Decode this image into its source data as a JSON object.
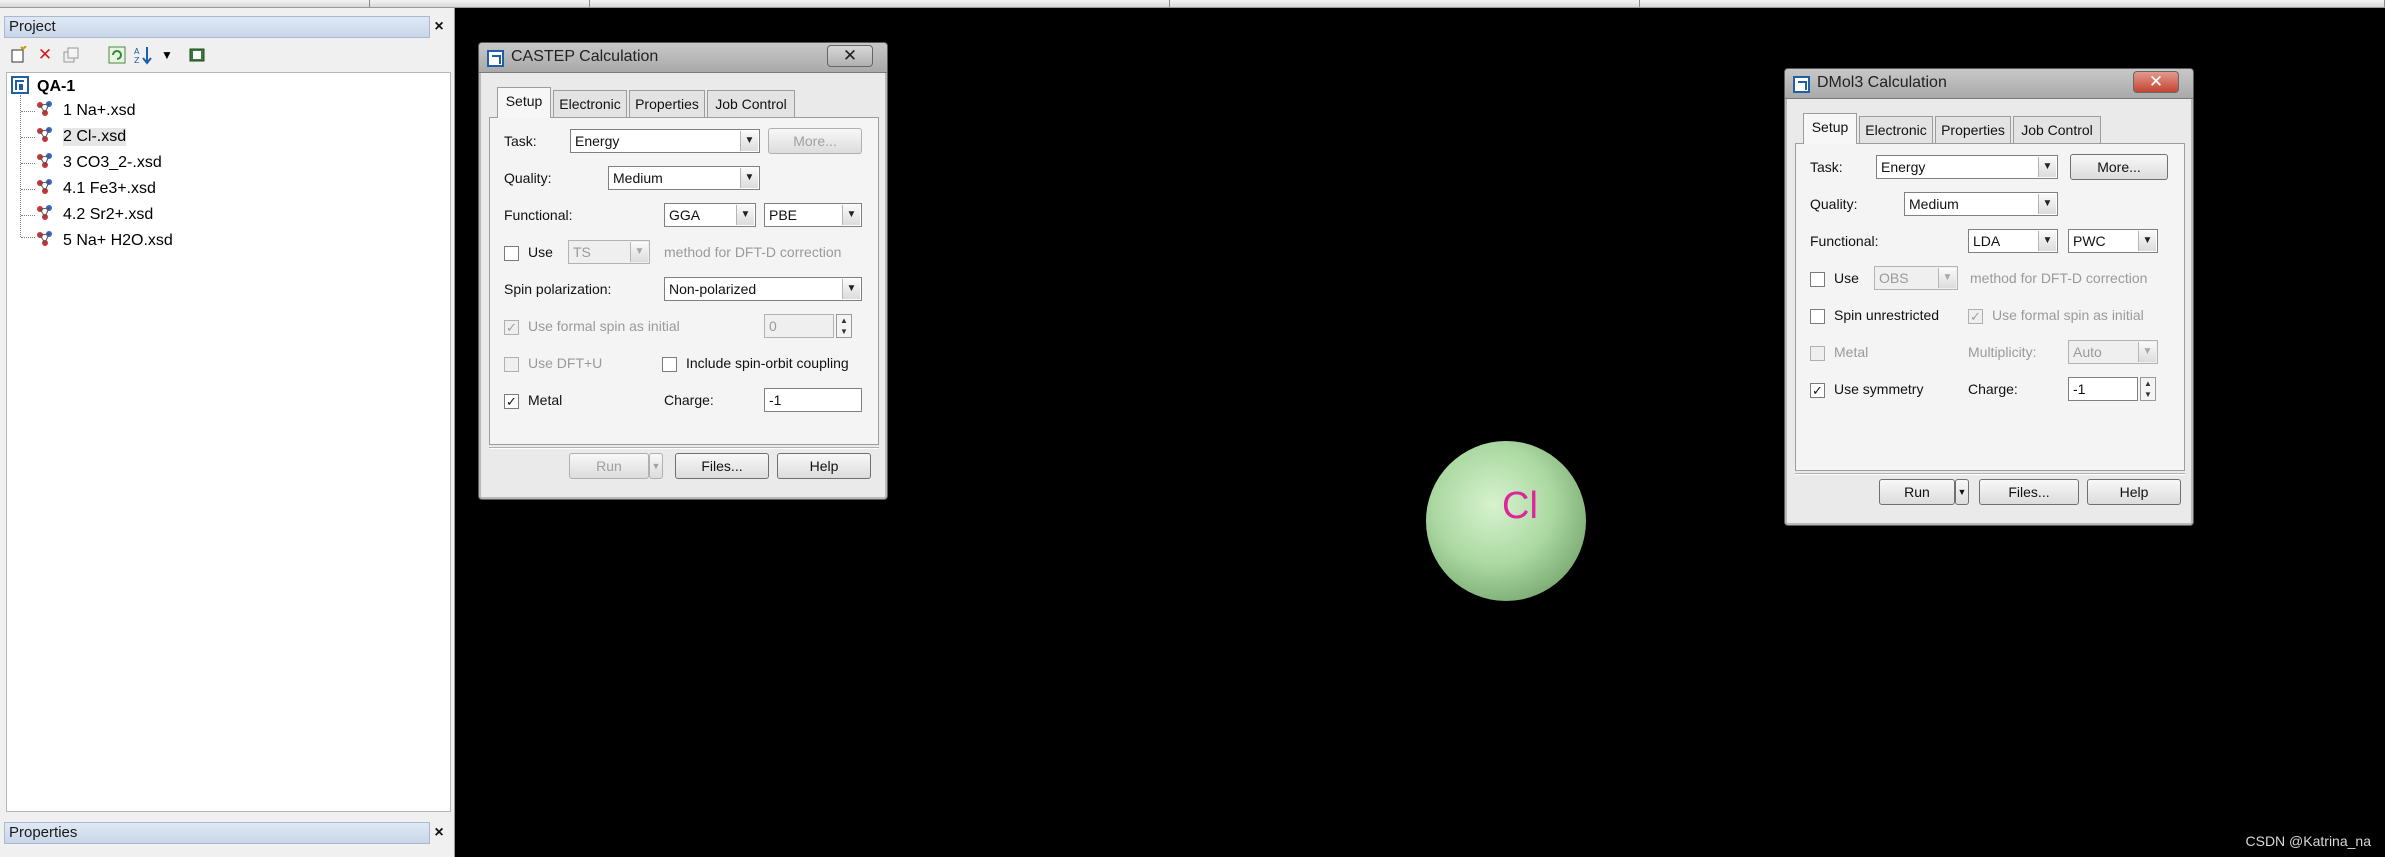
{
  "project_panel": {
    "title": "Project",
    "close": "×",
    "root": "QA-1",
    "items": [
      {
        "label": "1 Na+.xsd"
      },
      {
        "label": "2 Cl-.xsd"
      },
      {
        "label": "3 CO3_2-.xsd"
      },
      {
        "label": "4.1 Fe3+.xsd"
      },
      {
        "label": "4.2 Sr2+.xsd"
      },
      {
        "label": "5 Na+ H2O.xsd"
      }
    ]
  },
  "properties_panel": {
    "title": "Properties",
    "close": "×"
  },
  "castep": {
    "title": "CASTEP Calculation",
    "close": "✕",
    "tabs": [
      "Setup",
      "Electronic",
      "Properties",
      "Job Control"
    ],
    "task_label": "Task:",
    "task_value": "Energy",
    "more_button": "More...",
    "quality_label": "Quality:",
    "quality_value": "Medium",
    "functional_label": "Functional:",
    "functional_type": "GGA",
    "functional_value": "PBE",
    "use_label": "Use",
    "dftd_value": "TS",
    "dftd_text": "method for DFT-D correction",
    "spin_label": "Spin polarization:",
    "spin_value": "Non-polarized",
    "formal_spin_label": "Use formal spin as initial",
    "formal_spin_value": "0",
    "dftu_label": "Use DFT+U",
    "spin_orbit_label": "Include spin-orbit coupling",
    "metal_label": "Metal",
    "metal_check": "✓",
    "charge_label": "Charge:",
    "charge_value": "-1",
    "run_button": "Run",
    "files_button": "Files...",
    "help_button": "Help"
  },
  "dmol3": {
    "title": "DMol3 Calculation",
    "close": "✕",
    "tabs": [
      "Setup",
      "Electronic",
      "Properties",
      "Job Control"
    ],
    "task_label": "Task:",
    "task_value": "Energy",
    "more_button": "More...",
    "quality_label": "Quality:",
    "quality_value": "Medium",
    "functional_label": "Functional:",
    "functional_type": "LDA",
    "functional_value": "PWC",
    "use_label": "Use",
    "dftd_value": "OBS",
    "dftd_text": "method for DFT-D correction",
    "spin_unrestricted_label": "Spin unrestricted",
    "formal_spin_label": "Use formal spin as initial",
    "metal_label": "Metal",
    "multiplicity_label": "Multiplicity:",
    "multiplicity_value": "Auto",
    "symmetry_label": "Use symmetry",
    "symmetry_check": "✓",
    "charge_label": "Charge:",
    "charge_value": "-1",
    "run_button": "Run",
    "files_button": "Files...",
    "help_button": "Help"
  },
  "viewer": {
    "atom_label": "Cl",
    "watermark": "CSDN @Katrina_na"
  }
}
